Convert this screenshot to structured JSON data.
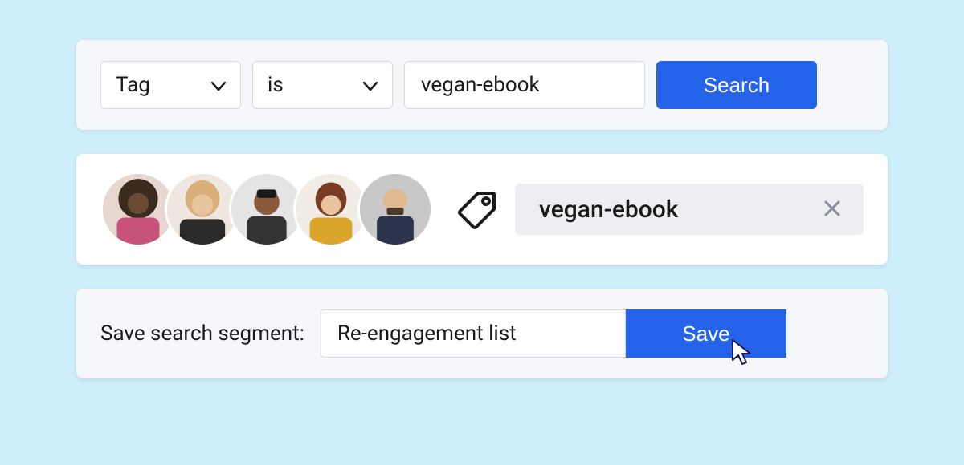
{
  "filter": {
    "field_label": "Tag",
    "operator_label": "is",
    "value": "vegan-ebook",
    "search_button": "Search"
  },
  "results": {
    "tag_chip": "vegan-ebook",
    "tag_icon": "tag-icon",
    "avatars_count": 5
  },
  "save_segment": {
    "label": "Save search segment:",
    "input_value": "Re-engagement list",
    "button": "Save"
  },
  "colors": {
    "primary": "#2563eb",
    "page_bg": "#cdeefb",
    "card_bg": "#f6f7fb"
  }
}
